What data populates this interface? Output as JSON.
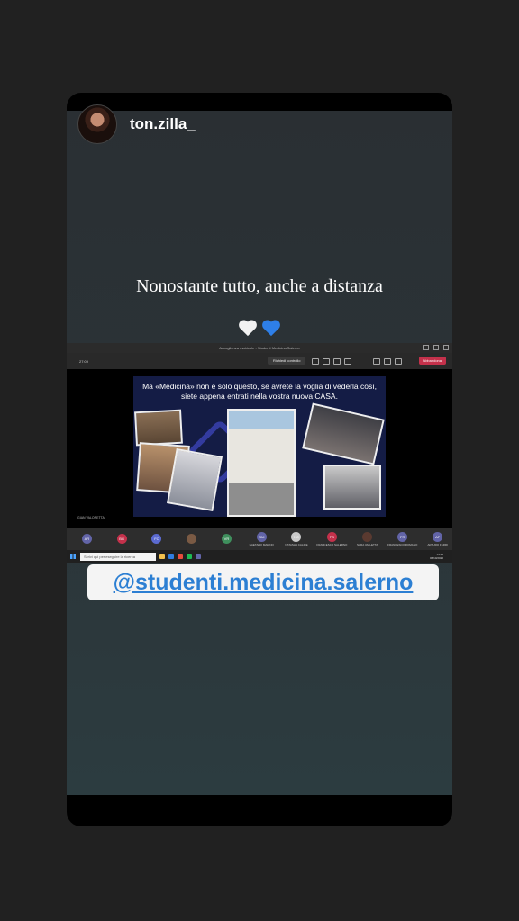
{
  "story": {
    "username": "ton.zilla_",
    "caption": "Nonostante tutto, anche a distanza",
    "hearts": [
      "white-heart",
      "blue-heart"
    ],
    "mention": "@studenti.medicina.salerno",
    "colors": {
      "mention_text": "#2c7fd3",
      "mention_bg": "#f4f4f4",
      "leave_button": "#c4314b"
    }
  },
  "meeting": {
    "window_title": "Accoglienza matricole - Studenti Medicina Salerno",
    "timer": "27:09",
    "control_button": "Richiedi controllo",
    "leave_button": "Abbandona",
    "presenter_name": "GIAN VALORETTA",
    "slide_text": "Ma «Medicina» non è solo questo, se avrete la voglia di vederla così, siete appena entrati nella vostra nuova CASA.",
    "participants": [
      {
        "initials": "AR",
        "name": "",
        "color": "#6264a7"
      },
      {
        "initials": "BG",
        "name": "",
        "color": "#c4314b"
      },
      {
        "initials": "FC",
        "name": "",
        "color": "#5b6ad0"
      },
      {
        "initials": "",
        "name": "",
        "color": "#7a5a44"
      },
      {
        "initials": "VR",
        "name": "",
        "color": "#3f8f5d"
      },
      {
        "initials": "GM",
        "name": "GAETANO MARINO",
        "color": "#6264a7"
      },
      {
        "initials": "NC",
        "name": "NATASHA CALICE",
        "color": "#c9c9c9"
      },
      {
        "initials": "FS",
        "name": "FRANCESCO SALERNO",
        "color": "#c4314b"
      },
      {
        "initials": "",
        "name": "SARA VALLETTA",
        "color": "#5a3a30"
      },
      {
        "initials": "FR",
        "name": "FRANCESCO ROMANO",
        "color": "#6264a7"
      },
      {
        "initials": "AF",
        "name": "ARTURO FERRI",
        "color": "#6264a7"
      }
    ],
    "taskbar": {
      "search_placeholder": "Scrivi qui per eseguire la ricerca",
      "time": "17:35",
      "date": "06/10/2020"
    }
  }
}
